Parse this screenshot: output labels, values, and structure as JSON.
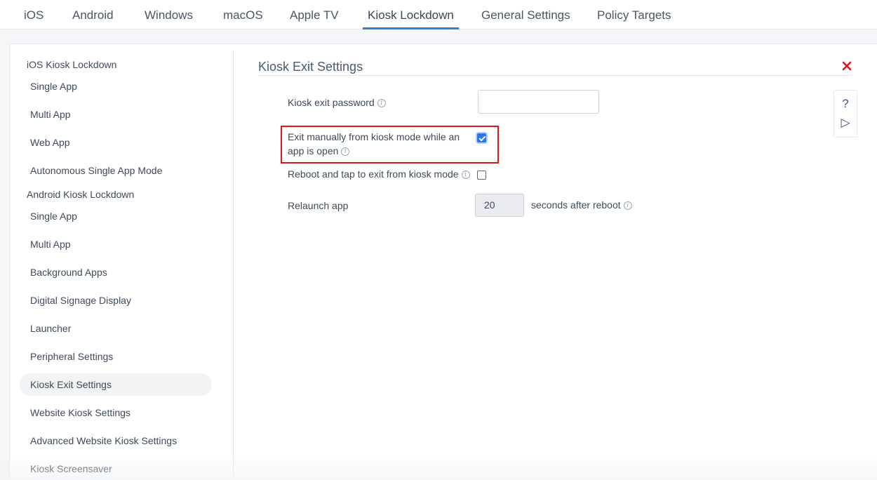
{
  "tabs": [
    {
      "label": "iOS"
    },
    {
      "label": "Android"
    },
    {
      "label": "Windows"
    },
    {
      "label": "macOS"
    },
    {
      "label": "Apple TV"
    },
    {
      "label": "Kiosk Lockdown",
      "active": true
    },
    {
      "label": "General Settings"
    },
    {
      "label": "Policy Targets"
    }
  ],
  "sidebar": {
    "ios_group": "iOS Kiosk Lockdown",
    "ios_items": [
      "Single App",
      "Multi App",
      "Web App",
      "Autonomous Single App Mode"
    ],
    "android_group": "Android Kiosk Lockdown",
    "android_items": [
      "Single App",
      "Multi App",
      "Background Apps",
      "Digital Signage Display",
      "Launcher",
      "Peripheral Settings",
      "Kiosk Exit Settings",
      "Website Kiosk Settings",
      "Advanced Website Kiosk Settings",
      "Kiosk Screensaver"
    ],
    "active_item": "Kiosk Exit Settings"
  },
  "section": {
    "title": "Kiosk Exit Settings"
  },
  "form": {
    "password_label": "Kiosk exit password",
    "password_value": "",
    "exit_manual_label_line1": "Exit manually from kiosk mode while an",
    "exit_manual_label_line2": "app is open",
    "exit_manual_checked": true,
    "reboot_label": "Reboot and tap to exit from kiosk mode",
    "reboot_checked": false,
    "relaunch_label": "Relaunch app",
    "relaunch_value": "20",
    "relaunch_suffix": "seconds after reboot"
  },
  "help": {
    "question": "?",
    "play": "▷"
  },
  "colors": {
    "accent": "#2d7fd0",
    "highlight": "#e0141b",
    "checkbox_on": "#2f74e6",
    "close": "#e0141b"
  },
  "icons": {
    "close": "close-icon",
    "info": "info-icon",
    "help": "help-icon",
    "play": "play-icon"
  }
}
